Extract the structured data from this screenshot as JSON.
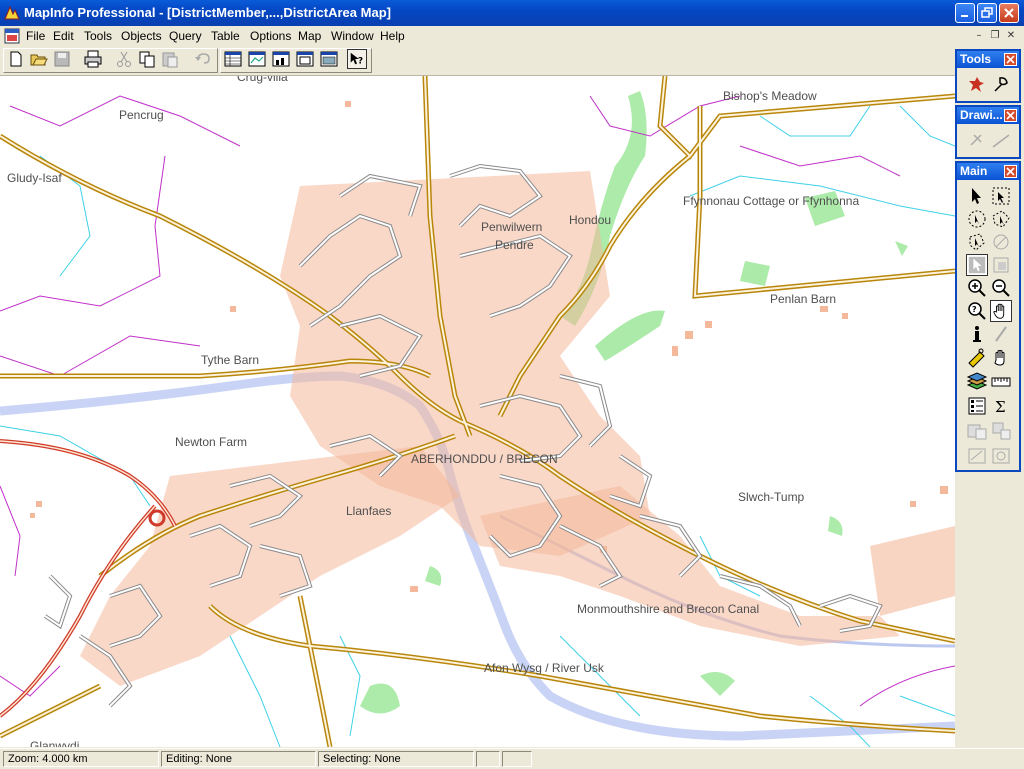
{
  "window": {
    "title": "MapInfo Professional - [DistrictMember,...,DistrictArea Map]"
  },
  "menu": [
    "File",
    "Edit",
    "Tools",
    "Objects",
    "Query",
    "Table",
    "Options",
    "Map",
    "Window",
    "Help"
  ],
  "toolbar_icons": [
    "new-icon",
    "open-icon",
    "save-icon",
    "print-icon",
    "cut-icon",
    "copy-icon",
    "paste-icon",
    "undo-icon",
    "browser-icon",
    "map-window-icon",
    "graph-icon",
    "layout-icon",
    "statistics-icon",
    "help-pointer-icon"
  ],
  "palettes": {
    "tools": {
      "title": "Tools"
    },
    "drawing": {
      "title": "Drawi..."
    },
    "main": {
      "title": "Main"
    }
  },
  "map_labels": {
    "crug_villa": "Crug-villa",
    "pencrug": "Pencrug",
    "gludy_isaf": "Gludy-Isaf",
    "bishops_meadow": "Bishop's Meadow",
    "ffynnonau": "Ffynnonau Cottage or Ffynhonna",
    "hondou": "Hondou",
    "penlan_barn": "Penlan Barn",
    "pendre": "Pendre",
    "penwilwern": "Penwilwern",
    "tythe_barn": "Tythe Barn",
    "newton_farm": "Newton Farm",
    "aberhonddu": "ABERHONDDU / BRECON",
    "llanfaes": "Llanfaes",
    "slwch_tump": "Slwch-Tump",
    "canal": "Monmouthshire and Brecon Canal",
    "river_usk": "Afon Wysg / River Usk",
    "glanwydi": "Glanwydi"
  },
  "status": {
    "zoom": "Zoom: 4.000 km",
    "editing": "Editing: None",
    "selecting": "Selecting: None"
  },
  "colors": {
    "titlebar": "#0a52d4",
    "road": "#b8860b",
    "major_road": "#d03a2a",
    "building": "#f4b89a",
    "river": "#c9d3f5",
    "woodland": "#9de79a",
    "boundary_cyan": "#3fd1e8",
    "boundary_magenta": "#c030c8"
  }
}
